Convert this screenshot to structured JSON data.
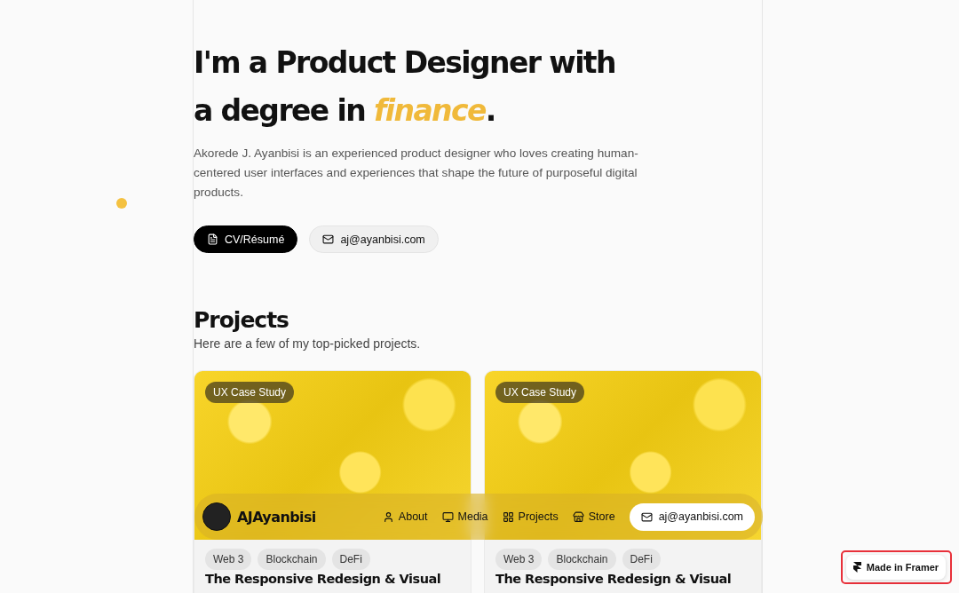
{
  "hero": {
    "heading_lines": [
      "I'm a Product Designer with",
      "a degree in *finance*."
    ],
    "intro": "Akorede J. Ayanbisi is an experienced product designer who loves creating human-centered user interfaces and experiences that shape the future of purposeful digital products.",
    "buttons": [
      {
        "label": "CV/Résumé",
        "kind": "primary"
      },
      {
        "label": "aj@ayanbisi.com",
        "kind": "secondary"
      }
    ]
  },
  "projects": {
    "title": "Projects",
    "subtitle": "Here are a few of my top-picked projects.",
    "cards": [
      {
        "badge": "UX Case Study",
        "tags": [
          "Web 3",
          "Blockchain",
          "DeFi"
        ],
        "title": "The Responsive Redesign & Visual"
      },
      {
        "badge": "UX Case Study",
        "tags": [
          "Web 3",
          "Blockchain",
          "DeFi"
        ],
        "title": "The Responsive Redesign & Visual"
      }
    ]
  },
  "nav": {
    "brand": "AJAyanbisi",
    "links": [
      {
        "label": "About",
        "kind": "person"
      },
      {
        "label": "Media",
        "kind": "monitor"
      },
      {
        "label": "Projects",
        "kind": "grid"
      },
      {
        "label": "Store",
        "kind": "store"
      }
    ],
    "email": "aj@ayanbisi.com"
  },
  "badge": {
    "label": "Made in Framer"
  }
}
